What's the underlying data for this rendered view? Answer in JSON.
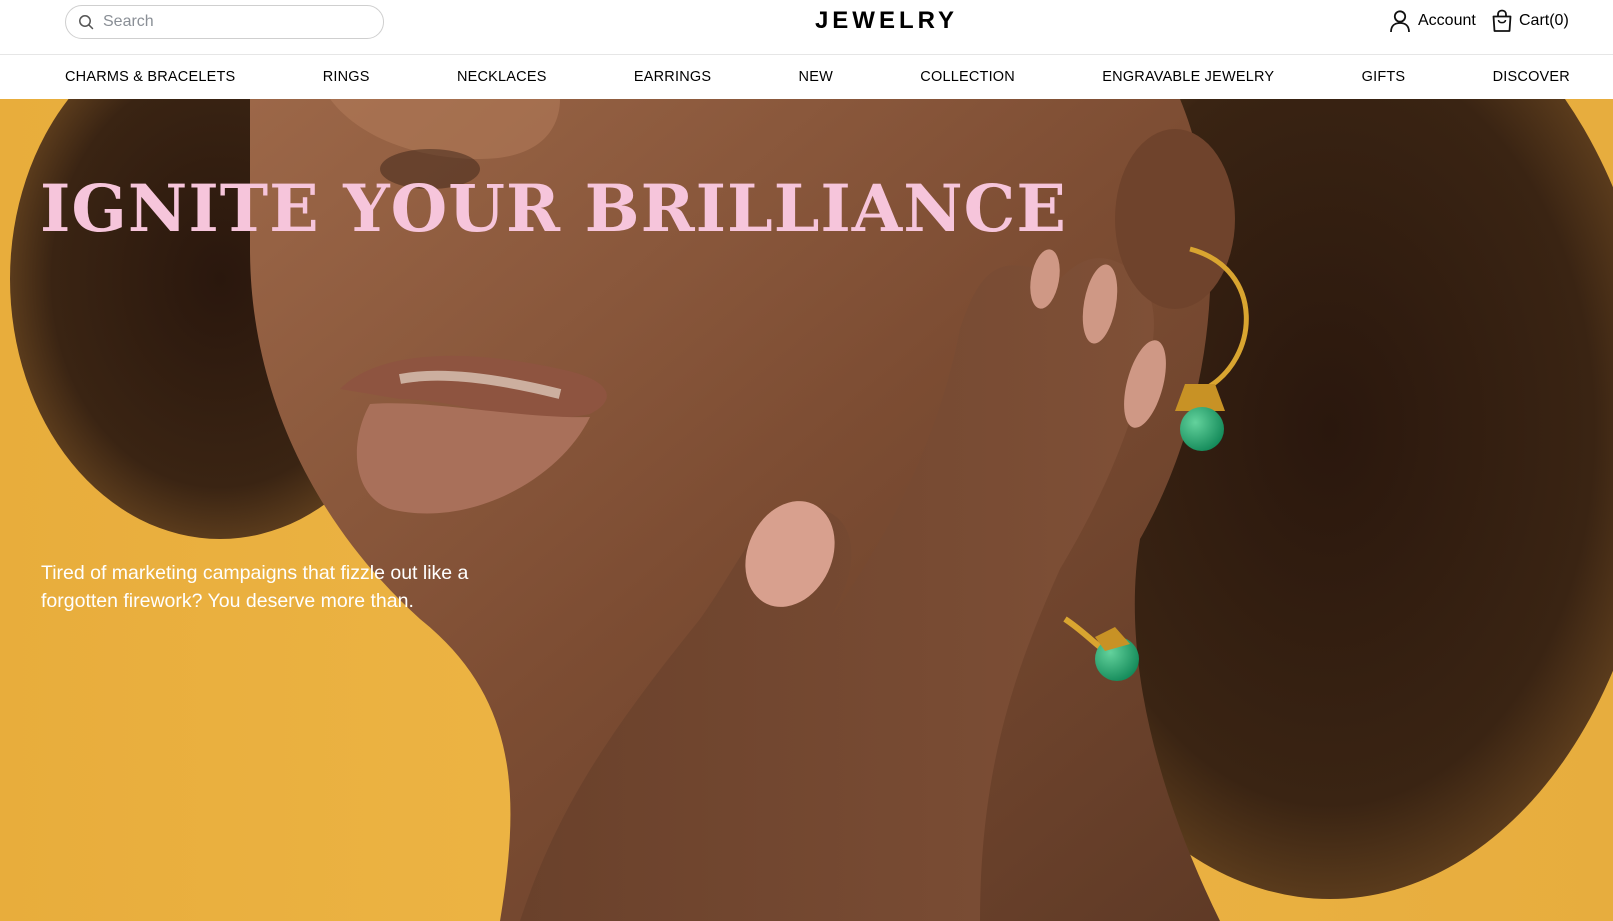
{
  "header": {
    "search": {
      "placeholder": "Search",
      "icon": "search-icon"
    },
    "brand": "JEWELRY",
    "account": {
      "label": "Account",
      "icon": "user-icon"
    },
    "cart": {
      "label": "Cart(0)",
      "icon": "shopping-bag-icon"
    }
  },
  "nav": {
    "items": [
      {
        "label": "CHARMS & BRACELETS"
      },
      {
        "label": "RINGS"
      },
      {
        "label": "NECKLACES"
      },
      {
        "label": "EARRINGS"
      },
      {
        "label": "NEW"
      },
      {
        "label": "COLLECTION"
      },
      {
        "label": "ENGRAVABLE JEWELRY"
      },
      {
        "label": "GIFTS"
      },
      {
        "label": "DISCOVER"
      }
    ]
  },
  "hero": {
    "title": "IGNITE YOUR BRILLIANCE",
    "copy": "Tired of marketing campaigns that fizzle out like a forgotten firework? You deserve more than.",
    "colors": {
      "background": "#edb545",
      "title": "#f6c5db",
      "copy": "#ffffff",
      "gem": "#1f9e6a",
      "gold": "#d9a530"
    }
  }
}
